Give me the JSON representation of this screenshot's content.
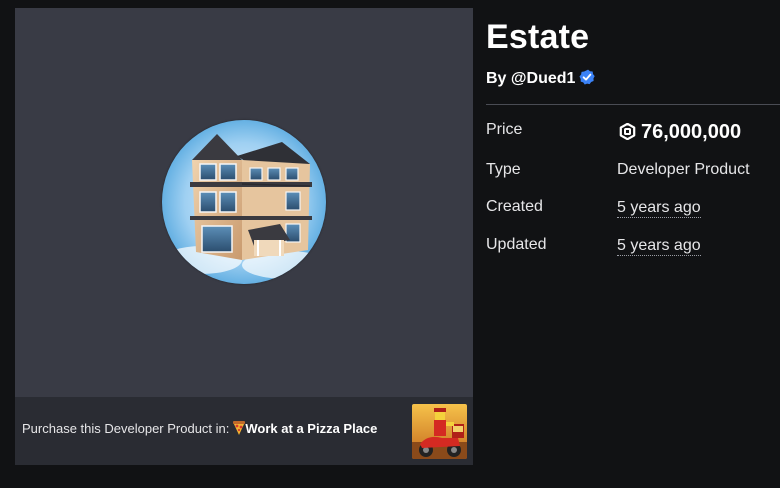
{
  "item": {
    "title": "Estate",
    "creator_prefix": "By",
    "creator_name": "@Dued1"
  },
  "details": {
    "price_label": "Price",
    "price_value": "76,000,000",
    "type_label": "Type",
    "type_value": "Developer Product",
    "created_label": "Created",
    "created_value": "5 years ago",
    "updated_label": "Updated",
    "updated_value": "5 years ago"
  },
  "purchase": {
    "prefix": "Purchase this Developer Product in:",
    "game_name": "Work at a Pizza Place"
  },
  "icons": {
    "verified": "verified-badge-icon",
    "currency": "robux-icon",
    "game_emoji": "pizza-icon"
  },
  "colors": {
    "background": "#111214",
    "card": "#393b45",
    "purchase_bar": "#2a2c33",
    "verified_blue": "#3b82f6",
    "text": "#e6e6e8"
  }
}
